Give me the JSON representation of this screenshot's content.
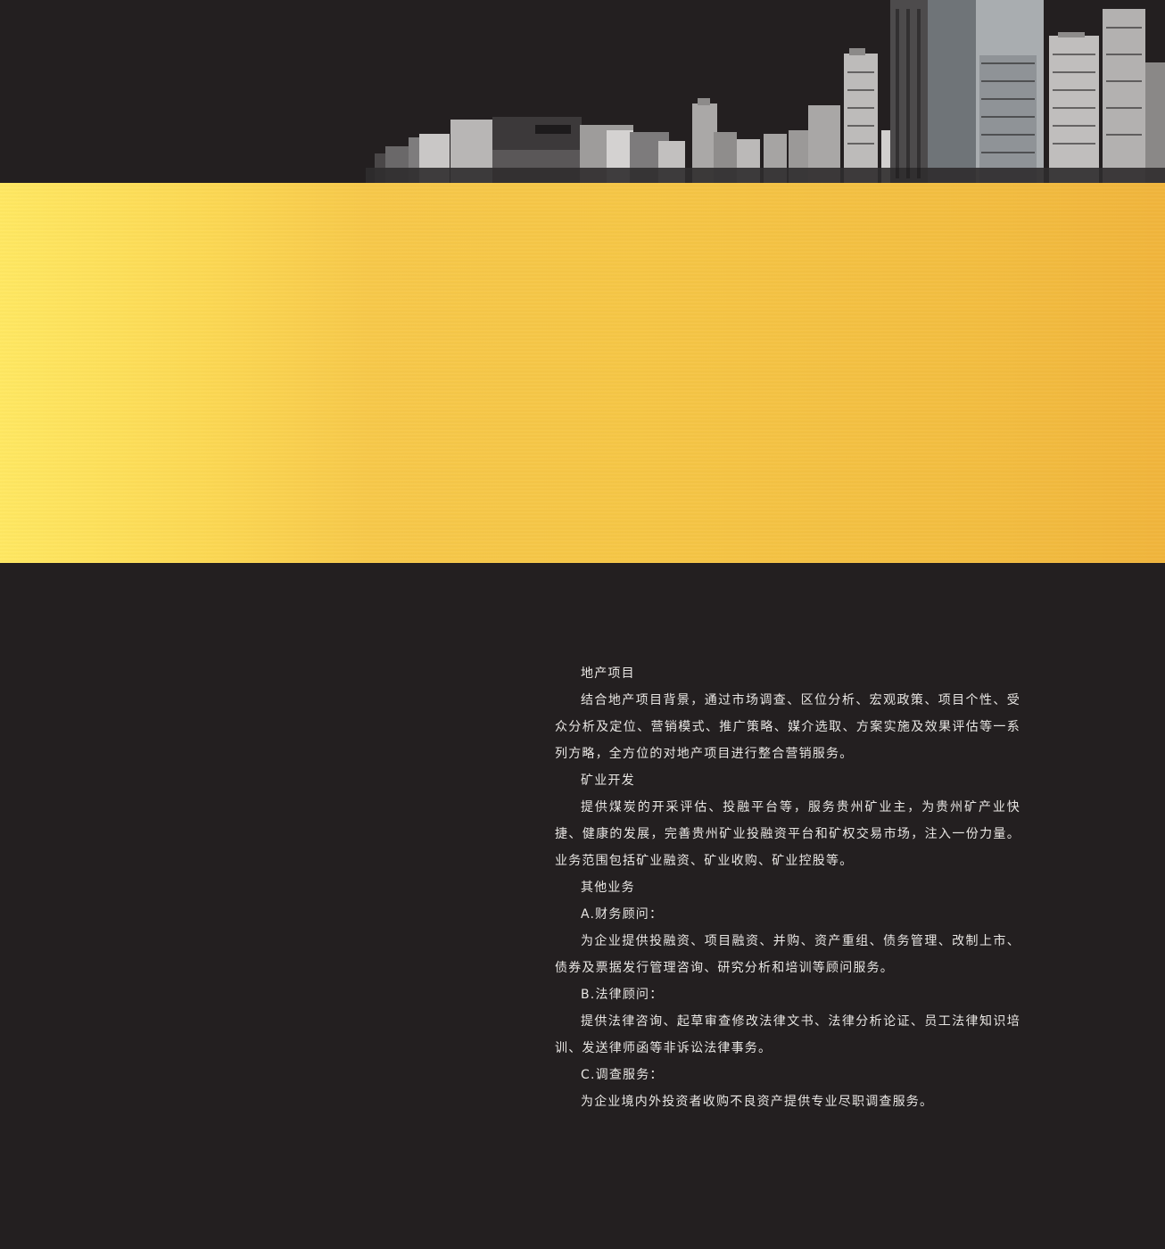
{
  "sections": {
    "realestate_title": "地产项目",
    "realestate_body": "结合地产项目背景，通过市场调查、区位分析、宏观政策、项目个性、受众分析及定位、营销模式、推广策略、媒介选取、方案实施及效果评估等一系列方略，全方位的对地产项目进行整合营销服务。",
    "mining_title": "矿业开发",
    "mining_body": "提供煤炭的开采评估、投融平台等，服务贵州矿业主，为贵州矿产业快捷、健康的发展，完善贵州矿业投融资平台和矿权交易市场，注入一份力量。业务范围包括矿业融资、矿业收购、矿业控股等。",
    "other_title": "其他业务",
    "finance_title": "A.财务顾问：",
    "finance_body": "为企业提供投融资、项目融资、并购、资产重组、债务管理、改制上市、债券及票据发行管理咨询、研究分析和培训等顾问服务。",
    "legal_title": "B.法律顾问：",
    "legal_body": "提供法律咨询、起草审查修改法律文书、法律分析论证、员工法律知识培训、发送律师函等非诉讼法律事务。",
    "survey_title": "C.调查服务：",
    "survey_body": "为企业境内外投资者收购不良资产提供专业尽职调查服务。"
  },
  "colors": {
    "background": "#231f20",
    "gold_light": "#ffe862",
    "gold_dark": "#f1b53c",
    "text": "#e8e6e3"
  }
}
